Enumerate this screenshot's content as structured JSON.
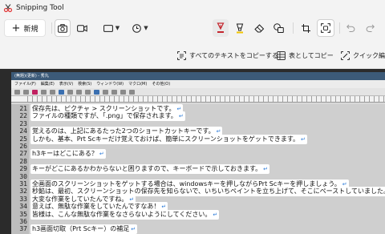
{
  "window": {
    "title": "Snipping Tool"
  },
  "toolbar": {
    "new_label": "新規"
  },
  "actions": {
    "copy_all_text": "すべてのテキストをコピーする",
    "copy_as_table": "表としてコピー",
    "quick_edit": "クイック編集"
  },
  "colors": {
    "pen_red": "#c4262e",
    "highlighter_yellow": "#f2c500",
    "accent_blue": "#2a7ad8"
  },
  "capture": {
    "title": "(無題)(更新) - 秀丸",
    "menu": [
      "ファイル(F)",
      "編集(E)",
      "表示(V)",
      "検索(S)",
      "ウィンドウ(W)",
      "マクロ(M)",
      "その他(O)"
    ],
    "lines": [
      {
        "num": "21",
        "text": "保存先は、ピクチャ > スクリーンショットです。"
      },
      {
        "num": "22",
        "text": "ファイルの種類ですが、「.png」で保存されます。"
      },
      {
        "num": "23",
        "text": ""
      },
      {
        "num": "24",
        "text": "覚えるのは、上記にあるたった2つのショートカットキーです。"
      },
      {
        "num": "25",
        "text": "しかも、基本、Prt Scキーだけ覚えておけば、簡単にスクリーンショットをゲットできます。"
      },
      {
        "num": "26",
        "text": ""
      },
      {
        "num": "27",
        "text": "h3キーはどこにある？"
      },
      {
        "num": "28",
        "text": ""
      },
      {
        "num": "29",
        "text": "キーがどこにあるかわからないと困りますので、キーボードで示しておきます。"
      },
      {
        "num": "30",
        "text": ""
      },
      {
        "num": "31",
        "text": "全画面のスクリーンショットをゲットする場合は、windowsキーを押しながらPrt Scキーを押しましょう。"
      },
      {
        "num": "32",
        "text": "秒餡は、最初、スクリーンショットの保存先を知らないで、いちいちペイントを立ち上げて、そこにペーストしていました。"
      },
      {
        "num": "33",
        "text": "大変な作業をしていたんですね。"
      },
      {
        "num": "34",
        "text": "意えば、無駄な作業をしていたんですなあ！"
      },
      {
        "num": "35",
        "text": "皆様は、こんな無駄な作業をなさらないようにしてください。"
      },
      {
        "num": "36",
        "text": ""
      },
      {
        "num": "37",
        "text": "h3画面切取（Prt Scキー）の補足"
      }
    ]
  }
}
